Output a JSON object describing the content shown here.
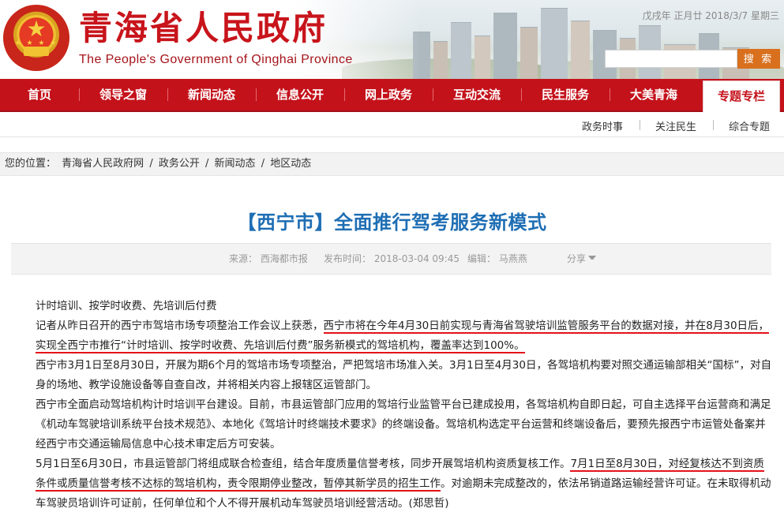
{
  "header": {
    "title": "青海省人民政府",
    "subtitle": "The People's Government of Qinghai Province",
    "date": "戊戌年  正月廿  2018/3/7  星期三",
    "search_placeholder": "",
    "search_button": "搜 索"
  },
  "nav": {
    "items": [
      "首页",
      "领导之窗",
      "新闻动态",
      "信息公开",
      "网上政务",
      "互动交流",
      "民生服务",
      "大美青海",
      "专题专栏"
    ],
    "active": "专题专栏"
  },
  "subnav": {
    "items": [
      "政务时事",
      "关注民生",
      "综合专题"
    ]
  },
  "breadcrumb": {
    "prefix": "您的位置：",
    "items": [
      "青海省人民政府网",
      "政务公开",
      "新闻动态",
      "地区动态"
    ],
    "separator": "/"
  },
  "article": {
    "title": "【西宁市】全面推行驾考服务新模式",
    "source_label": "来源：",
    "source": "西海都市报",
    "time_label": "发布时间：",
    "time": "2018-03-04 09:45",
    "editor_label": "编辑：",
    "editor": "马燕燕",
    "share": "分享",
    "p1": "计时培训、按学时收费、先培训后付费",
    "p2a": "记者从昨日召开的西宁市驾培市场专项整治工作会议上获悉，",
    "p2b": "西宁市将在今年4月30日前实现与青海省驾驶培训监管服务平台的数据对接，并在8月30",
    "p2c": "日后，实现全西宁市推行“计时培训、按学时收费、先培训后付费”服务新模式的驾培机构，覆盖率达到100%。",
    "p3": "西宁市3月1日至8月30日，开展为期6个月的驾培市场专项整治，严把驾培市场准入关。3月1日至4月30日，各驾培机构要对照交通运输部相关“国标”，对自身的场地、教学设施设备等自查自改，并将相关内容上报辖区运管部门。",
    "p4": "西宁市全面启动驾培机构计时培训平台建设。目前，市县运管部门应用的驾培行业监管平台已建成投用，各驾培机构自即日起，可自主选择平台运营商和满足《机动车驾驶培训系统平台技术规范》、本地化《驾培计时终端技术要求》的终端设备。驾培机构选定平台运营和终端设备后，要预先报西宁市运管处备案并经西宁市交通运输局信息中心技术审定后方可安装。",
    "p5a": "5月1日至6月30日，市县运管部门将组成联合检查组，结合年度质量信誉考核，同步开展驾培机构资质复核工作。",
    "p5b": "7月1日至8月30日，对经复核达不到",
    "p5c": "资质条件或质量信誉考核不达标的驾培机构，责令限期停业整改，暂停其新学员的招生工作",
    "p5d": "。对逾期未完成整改的，依法吊销道路运输经营许可证。在未取得机动车驾驶员培训许可证前，任何单位和个人不得开展机动车驾驶员培训经营活动。",
    "signature": "(郑思哲)"
  },
  "colors": {
    "brand_red": "#c4121b",
    "title_blue": "#1e6eb4",
    "search_orange": "#d8701e",
    "underline_red": "#e3121a"
  }
}
